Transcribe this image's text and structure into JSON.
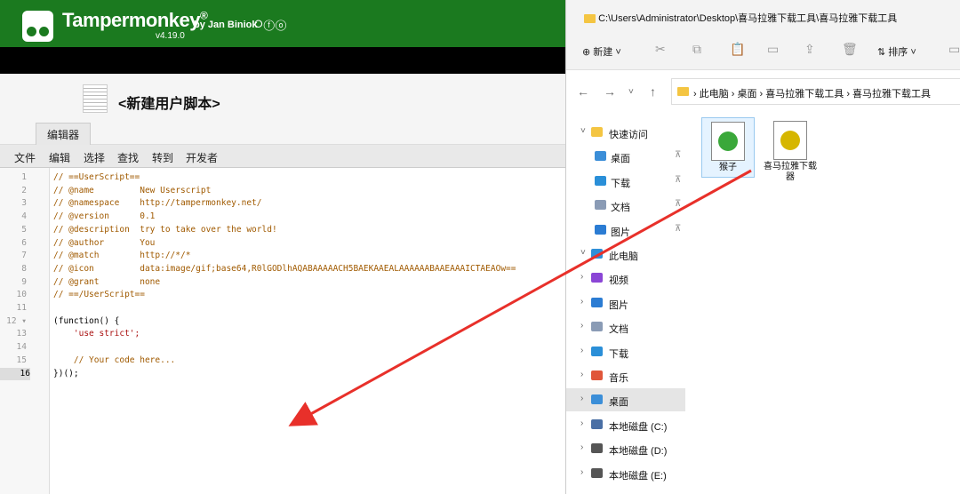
{
  "tampermonkey": {
    "title": "Tampermonkey",
    "reg": "®",
    "author": "by Jan Biniok",
    "version": "v4.19.0",
    "social_icons": "⭘ⓕⓞ",
    "script_name": "<新建用户脚本>",
    "tab": "编辑器",
    "menu": [
      "文件",
      "编辑",
      "选择",
      "查找",
      "转到",
      "开发者"
    ],
    "code_lines": [
      {
        "n": "1",
        "t": "// ==UserScript==",
        "c": "cm"
      },
      {
        "n": "2",
        "t": "// @name         New Userscript",
        "c": "cm"
      },
      {
        "n": "3",
        "t": "// @namespace    http://tampermonkey.net/",
        "c": "cm"
      },
      {
        "n": "4",
        "t": "// @version      0.1",
        "c": "cm"
      },
      {
        "n": "5",
        "t": "// @description  try to take over the world!",
        "c": "cm"
      },
      {
        "n": "6",
        "t": "// @author       You",
        "c": "cm"
      },
      {
        "n": "7",
        "t": "// @match        http://*/*",
        "c": "cm"
      },
      {
        "n": "8",
        "t": "// @icon         data:image/gif;base64,R0lGODlhAQABAAAAACH5BAEKAAEALAAAAAABAAEAAAICTAEAOw==",
        "c": "cm"
      },
      {
        "n": "9",
        "t": "// @grant        none",
        "c": "cm"
      },
      {
        "n": "10",
        "t": "// ==/UserScript==",
        "c": "cm"
      },
      {
        "n": "11",
        "t": "",
        "c": "plain"
      },
      {
        "n": "12 ▾",
        "t": "(function() {",
        "c": "plain"
      },
      {
        "n": "13",
        "t": "    'use strict';",
        "c": "str"
      },
      {
        "n": "14",
        "t": "",
        "c": "plain"
      },
      {
        "n": "15",
        "t": "    // Your code here...",
        "c": "cm"
      },
      {
        "n": "16",
        "t": "})();",
        "c": "plain"
      }
    ]
  },
  "explorer": {
    "title_path": "C:\\Users\\Administrator\\Desktop\\喜马拉雅下载工具\\喜马拉雅下载工具",
    "toolbar": {
      "new": "⊕  新建 ˅",
      "sort": "⇅  排序 ˅"
    },
    "breadcrumb": "›  此电脑  ›  桌面  ›  喜马拉雅下载工具  ›  喜马拉雅下载工具",
    "sidebar": [
      {
        "label": "快速访问",
        "chev": "˅",
        "icon": "#f4c542"
      },
      {
        "label": "桌面",
        "pin": "📌",
        "icon": "#3b8ed8"
      },
      {
        "label": "下载",
        "pin": "📌",
        "icon": "#2a8fd8"
      },
      {
        "label": "文档",
        "pin": "📌",
        "icon": "#8a9bb5"
      },
      {
        "label": "图片",
        "pin": "📌",
        "icon": "#2b7cd3"
      },
      {
        "label": "此电脑",
        "chev": "˅",
        "icon": "#2f8fd8"
      },
      {
        "label": "视频",
        "chev": "›",
        "icon": "#8b46d6"
      },
      {
        "label": "图片",
        "chev": "›",
        "icon": "#2b7cd3"
      },
      {
        "label": "文档",
        "chev": "›",
        "icon": "#8a9bb5"
      },
      {
        "label": "下载",
        "chev": "›",
        "icon": "#2a8fd8"
      },
      {
        "label": "音乐",
        "chev": "›",
        "icon": "#e0563a"
      },
      {
        "label": "桌面",
        "chev": "›",
        "icon": "#3b8ed8",
        "selected": true
      },
      {
        "label": "本地磁盘 (C:)",
        "chev": "›",
        "icon": "#4a6fa5"
      },
      {
        "label": "本地磁盘 (D:)",
        "chev": "›",
        "icon": "#555555"
      },
      {
        "label": "本地磁盘 (E:)",
        "chev": "›",
        "icon": "#555555"
      }
    ],
    "files": [
      {
        "name": "猴子",
        "icon_color": "#3aa83a"
      },
      {
        "name": "喜马拉雅下载器",
        "icon_color": "#d6b600"
      }
    ]
  },
  "colors": {
    "tm_green": "#1b7a1f",
    "arrow": "#e8302a"
  }
}
